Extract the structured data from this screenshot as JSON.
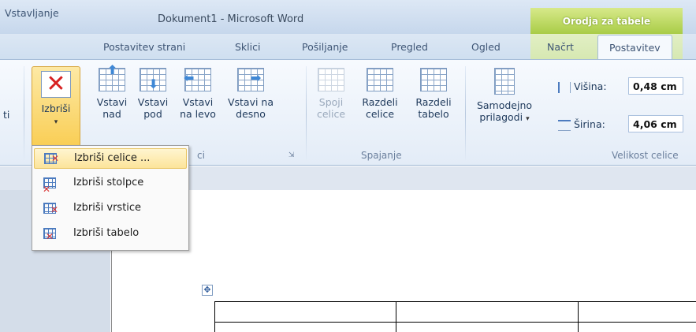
{
  "window": {
    "title": "Dokument1 - Microsoft Word",
    "context_tab_group": "Orodja za tabele"
  },
  "tabs": [
    {
      "label": "Vstavljanje"
    },
    {
      "label": "Postavitev strani"
    },
    {
      "label": "Sklici"
    },
    {
      "label": "Pošiljanje"
    },
    {
      "label": "Pregled"
    },
    {
      "label": "Ogled"
    },
    {
      "label": "Načrt"
    },
    {
      "label": "Postavitev",
      "active": true
    }
  ],
  "ribbon": {
    "partial_left_label": "ti",
    "izbrisi": {
      "label": "Izbriši"
    },
    "vstavi_nad": {
      "line1": "Vstavi",
      "line2": "nad"
    },
    "vstavi_pod": {
      "line1": "Vstavi",
      "line2": "pod"
    },
    "vstavi_levo": {
      "line1": "Vstavi",
      "line2": "na levo"
    },
    "vstavi_desno": {
      "line1": "Vstavi na",
      "line2": "desno"
    },
    "group_rows_cols_label_partial": "ci",
    "spoji_celice": {
      "line1": "Spoji",
      "line2": "celice",
      "disabled": true
    },
    "razdeli_celice": {
      "line1": "Razdeli",
      "line2": "celice"
    },
    "razdeli_tabelo": {
      "line1": "Razdeli",
      "line2": "tabelo"
    },
    "group_spajanje_label": "Spajanje",
    "samodejno": {
      "line1": "Samodejno",
      "line2": "prilagodi"
    },
    "visina": {
      "label": "Višina:",
      "value": "0,48 cm"
    },
    "sirina": {
      "label": "Širina:",
      "value": "4,06 cm"
    },
    "group_velikost_label": "Velikost celice"
  },
  "delete_menu": {
    "items": [
      {
        "label": "Izbriši celice ...",
        "icon": "delete-cells-icon",
        "hover": true
      },
      {
        "label": "Izbriši stolpce",
        "icon": "delete-columns-icon"
      },
      {
        "label": "Izbriši vrstice",
        "icon": "delete-rows-icon"
      },
      {
        "label": "Izbriši tabelo",
        "icon": "delete-table-icon"
      }
    ]
  },
  "colors": {
    "context_tab": "#a9cc47",
    "hover_highlight": "#fce49a",
    "delete_red": "#d72020"
  }
}
